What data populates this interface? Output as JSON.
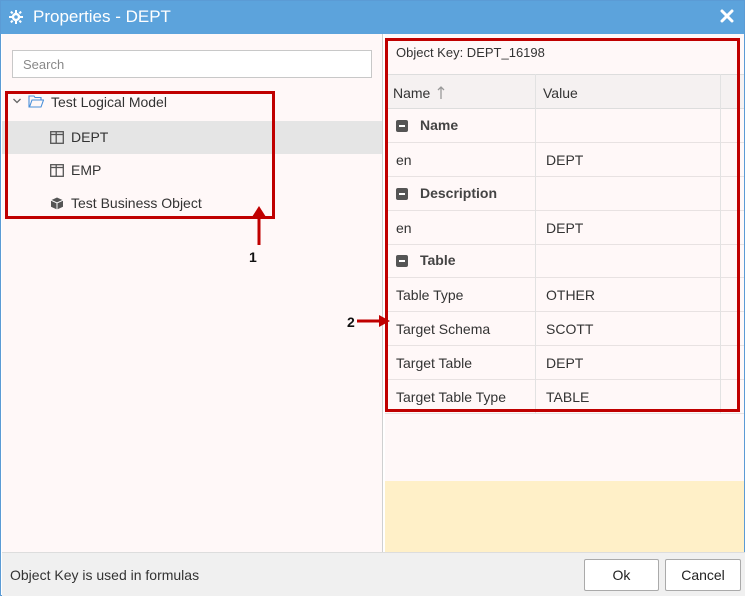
{
  "window": {
    "title": "Properties - DEPT"
  },
  "search": {
    "placeholder": "Search"
  },
  "tree": {
    "root": {
      "label": "Test Logical Model"
    },
    "items": [
      {
        "label": "DEPT",
        "icon": "table-icon",
        "selected": true
      },
      {
        "label": "EMP",
        "icon": "table-icon",
        "selected": false
      },
      {
        "label": "Test Business Object",
        "icon": "cube-icon",
        "selected": false
      }
    ]
  },
  "annotations": {
    "label1": "1",
    "label2": "2",
    "color": "#c00000"
  },
  "properties": {
    "object_key": "Object Key: DEPT_16198",
    "columns": {
      "name": "Name",
      "value": "Value"
    },
    "groups": [
      {
        "label": "Name",
        "rows": [
          {
            "name": "en",
            "value": "DEPT"
          }
        ]
      },
      {
        "label": "Description",
        "rows": [
          {
            "name": "en",
            "value": "DEPT"
          }
        ]
      },
      {
        "label": "Table",
        "rows": [
          {
            "name": "Table Type",
            "value": "OTHER"
          },
          {
            "name": "Target Schema",
            "value": "SCOTT"
          },
          {
            "name": "Target Table",
            "value": "DEPT"
          },
          {
            "name": "Target Table Type",
            "value": "TABLE"
          }
        ]
      }
    ]
  },
  "footer": {
    "info": "Object Key is used in formulas",
    "ok_label": "Ok",
    "cancel_label": "Cancel"
  },
  "colors": {
    "titlebar": "#5ca3dc",
    "annotation": "#c00000",
    "highlight": "#fff0c8"
  }
}
